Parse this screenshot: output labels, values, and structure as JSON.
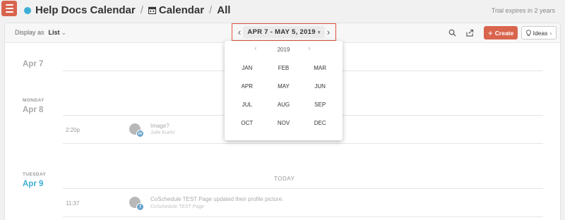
{
  "app": {
    "breadcrumb": {
      "calendar_name": "Help Docs Calendar",
      "section": "Calendar",
      "filter": "All",
      "separator": "/"
    },
    "trial_notice": "Trial expires in 2 years",
    "accent_color": "#d9644d",
    "brand_dot_color": "#3eaed6"
  },
  "toolbar": {
    "display_as_label": "Display as",
    "display_as_value": "List",
    "date_range": "APR 7 - MAY 5, 2019",
    "create_label": "Create",
    "ideas_label": "Ideas",
    "icons": [
      "search-icon",
      "share-icon",
      "plus-icon",
      "lightbulb-icon"
    ]
  },
  "picker": {
    "year": "2019",
    "months": [
      "JAN",
      "FEB",
      "MAR",
      "APR",
      "MAY",
      "JUN",
      "JUL",
      "AUG",
      "SEP",
      "OCT",
      "NOV",
      "DEC"
    ]
  },
  "list": {
    "partial_day": "Apr 7",
    "today_label": "TODAY",
    "days": [
      {
        "weekday": "MONDAY",
        "date": "Apr 8",
        "entries": [
          {
            "time": "2:20p",
            "title": "Image?",
            "subtitle": "Julie Kuehl",
            "badge": "in"
          }
        ]
      },
      {
        "weekday": "TUESDAY",
        "date": "Apr 9",
        "entries": [
          {
            "time": "11:37",
            "title": "CoSchedule TEST Page updated their profile picture.",
            "subtitle": "CoSchedule TEST Page",
            "badge": "f"
          }
        ]
      }
    ]
  }
}
